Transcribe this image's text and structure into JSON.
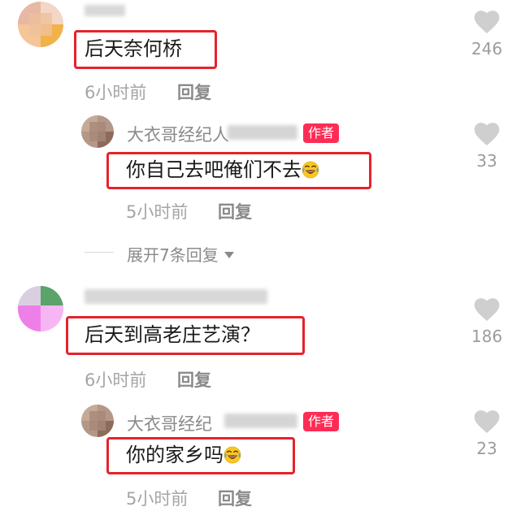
{
  "comments": [
    {
      "username": "▒▒▒",
      "text": "后天奈何桥",
      "time": "6小时前",
      "reply_label": "回复",
      "likes": "246",
      "replies": [
        {
          "username": "大衣哥经纪人",
          "author_badge": "作者",
          "text": "你自己去吧俺们不去",
          "time": "5小时前",
          "reply_label": "回复",
          "likes": "33"
        }
      ],
      "expand_label": "展开7条回复"
    },
    {
      "username": "▒▒▒▒▒▒▒▒▒▒▒",
      "text": "后天到高老庄艺演？",
      "time": "6小时前",
      "reply_label": "回复",
      "likes": "186",
      "replies": [
        {
          "username": "大衣哥经纪",
          "author_badge": "作者",
          "text": "你的家乡吗",
          "time": "5小时前",
          "reply_label": "回复",
          "likes": "23"
        }
      ]
    }
  ],
  "colors": {
    "highlight_box": "#e5232c",
    "author_badge": "#fe2c55",
    "meta_text": "#a5a5a5",
    "heart_icon": "#cfcfcf"
  },
  "icons": {
    "like": "heart-icon",
    "expand": "caret-down-icon",
    "emoji": "laughing-crying-emoji-icon"
  }
}
